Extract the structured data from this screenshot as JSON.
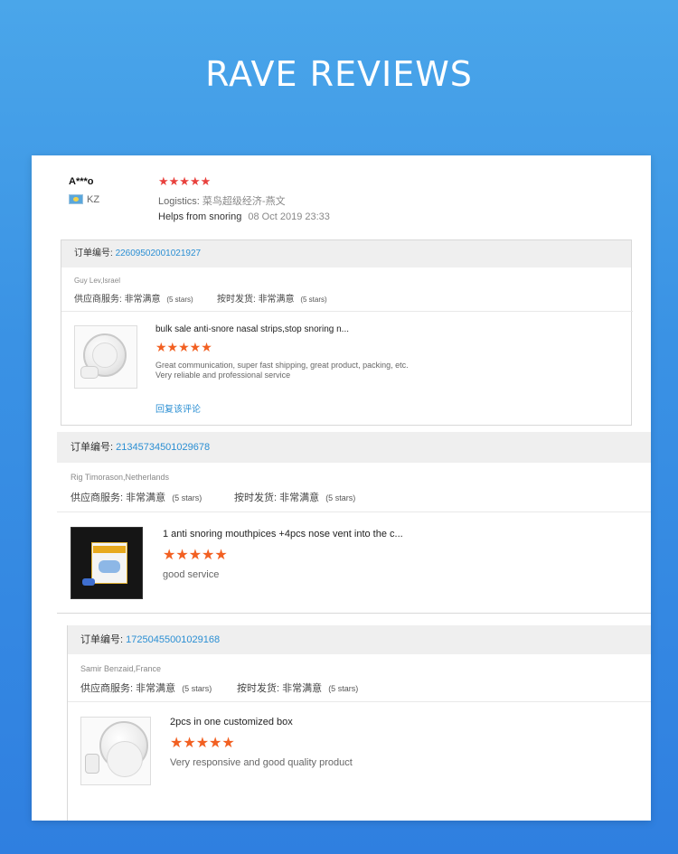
{
  "page": {
    "title": "RAVE REVIEWS"
  },
  "top_review": {
    "name": "A***o",
    "country": "KZ",
    "stars": "★★★★★",
    "logistics_label": "Logistics:",
    "logistics_value": "菜鸟超级经济-燕文",
    "feedback": "Helps from snoring",
    "date": "08 Oct 2019 23:33"
  },
  "orders": [
    {
      "order_label": "订单编号:",
      "order_number": "22609502001021927",
      "buyer": "Guy Lev,Israel",
      "supplier_label": "供应商服务:",
      "supplier_value": "非常满意",
      "supplier_stars": "(5 stars)",
      "shipping_label": "按时发货:",
      "shipping_value": "非常满意",
      "shipping_stars": "(5 stars)",
      "product_title": "bulk sale anti-snore nasal strips,stop snoring n...",
      "stars": "★★★★★",
      "comment_line1": "Great communication, super fast shipping, great product, packing, etc.",
      "comment_line2": "Very reliable and professional service",
      "reply": "回复该评论"
    },
    {
      "order_label": "订单编号:",
      "order_number": "21345734501029678",
      "buyer": "Rig Timorason,Netherlands",
      "supplier_label": "供应商服务:",
      "supplier_value": "非常满意",
      "supplier_stars": "(5 stars)",
      "shipping_label": "按时发货:",
      "shipping_value": "非常满意",
      "shipping_stars": "(5 stars)",
      "product_title": "1 anti snoring mouthpices +4pcs nose vent into the c...",
      "stars": "★★★★★",
      "comment_line1": "good service"
    },
    {
      "order_label": "订单编号:",
      "order_number": "17250455001029168",
      "buyer": "Samir Benzaid,France",
      "supplier_label": "供应商服务:",
      "supplier_value": "非常满意",
      "supplier_stars": "(5 stars)",
      "shipping_label": "按时发货:",
      "shipping_value": "非常满意",
      "shipping_stars": "(5 stars)",
      "product_title": "2pcs in one customized box",
      "stars": "★★★★★",
      "comment_line1": "Very responsive and good quality product"
    }
  ],
  "colors": {
    "accent_link": "#2b8fd3",
    "star_orange": "#f26022",
    "star_red": "#e8413d",
    "background_top": "#4aa6ea",
    "background_bottom": "#2f7fe0"
  }
}
